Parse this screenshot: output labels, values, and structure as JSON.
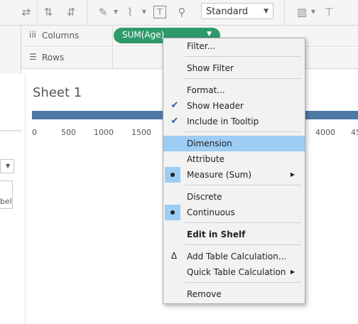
{
  "toolbar": {
    "mark_type": "Standard"
  },
  "shelves": {
    "columns_label": "Columns",
    "rows_label": "Rows",
    "columns_pill": "SUM(Age)"
  },
  "left": {
    "card_label_fragment": "bel"
  },
  "sheet": {
    "title": "Sheet 1",
    "axis_ticks": [
      "0",
      "500",
      "1000",
      "1500",
      "4000",
      "45"
    ]
  },
  "colors": {
    "pill": "#2e9a6b",
    "bar": "#4e79a7",
    "highlight": "#9dcdf5"
  },
  "menu": {
    "filter": "Filter...",
    "show_filter": "Show Filter",
    "format": "Format...",
    "show_header": "Show Header",
    "include_in_tooltip": "Include in Tooltip",
    "dimension": "Dimension",
    "attribute": "Attribute",
    "measure_sum": "Measure (Sum)",
    "discrete": "Discrete",
    "continuous": "Continuous",
    "edit_in_shelf": "Edit in Shelf",
    "add_table_calculation": "Add Table Calculation...",
    "quick_table_calculation": "Quick Table Calculation",
    "remove": "Remove"
  }
}
